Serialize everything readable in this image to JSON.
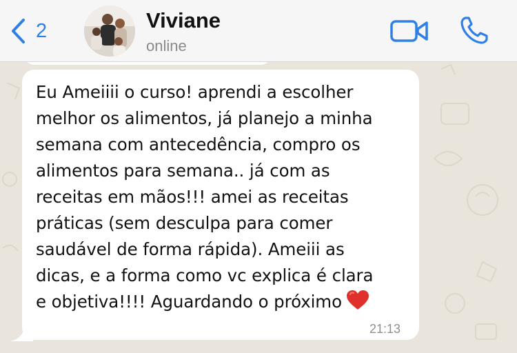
{
  "header": {
    "back_count": "2",
    "contact_name": "Viviane",
    "contact_status": "online",
    "icons": {
      "back": "chevron-left-icon",
      "video": "video-camera-icon",
      "call": "phone-icon"
    },
    "accent_color": "#2f7fe4"
  },
  "message": {
    "lines": [
      "Eu Ameiiii o curso! aprendi a escolher",
      "melhor os alimentos, já planejo a minha",
      "semana com antecedência, compro os",
      "alimentos para semana.. já com as",
      "receitas em mãos!!! amei as receitas",
      "práticas (sem desculpa para comer",
      "saudável de forma rápida). Ameiii as",
      "dicas, e a forma como vc explica é clara",
      "e objetiva!!!! Aguardando o próximo"
    ],
    "emoji": "red-heart-icon",
    "time": "21:13"
  }
}
